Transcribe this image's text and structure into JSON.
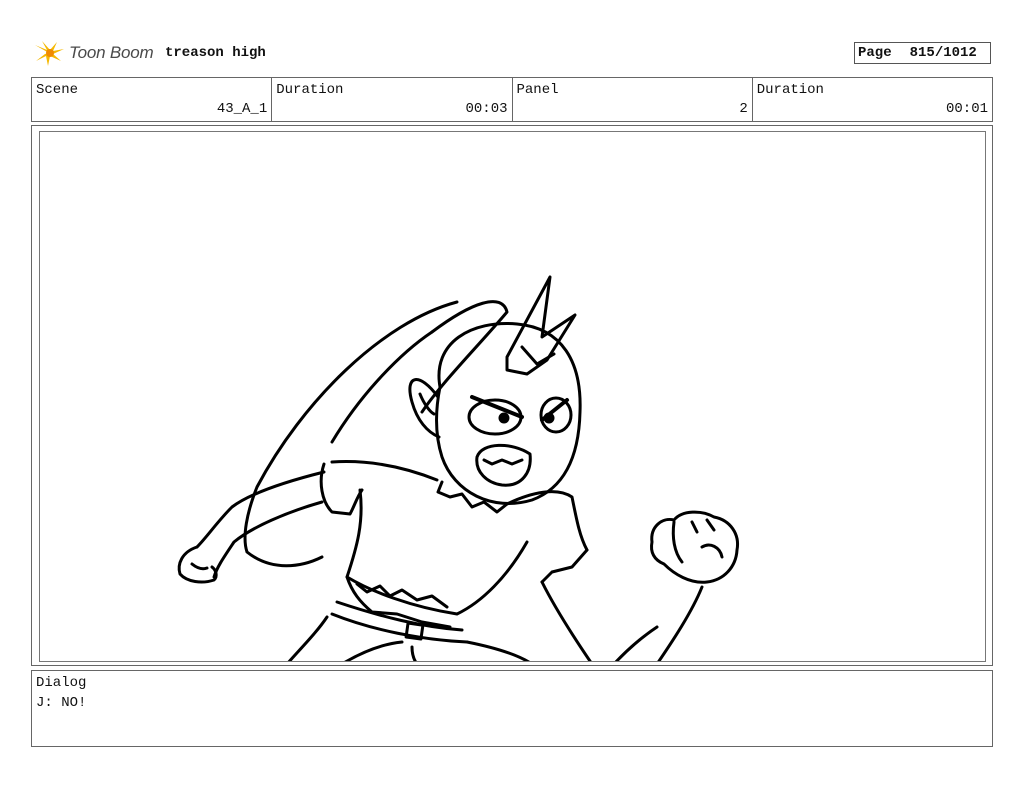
{
  "header": {
    "logo_text": "Toon Boom",
    "project_title": "treason high",
    "page_label": "Page",
    "page_value": "815/1012"
  },
  "info": {
    "scene_label": "Scene",
    "scene_value": "43_A_1",
    "scene_duration_label": "Duration",
    "scene_duration_value": "00:03",
    "panel_label": "Panel",
    "panel_value": "2",
    "panel_duration_label": "Duration",
    "panel_duration_value": "00:01"
  },
  "dialog": {
    "label": "Dialog",
    "text": "J: NO!"
  }
}
